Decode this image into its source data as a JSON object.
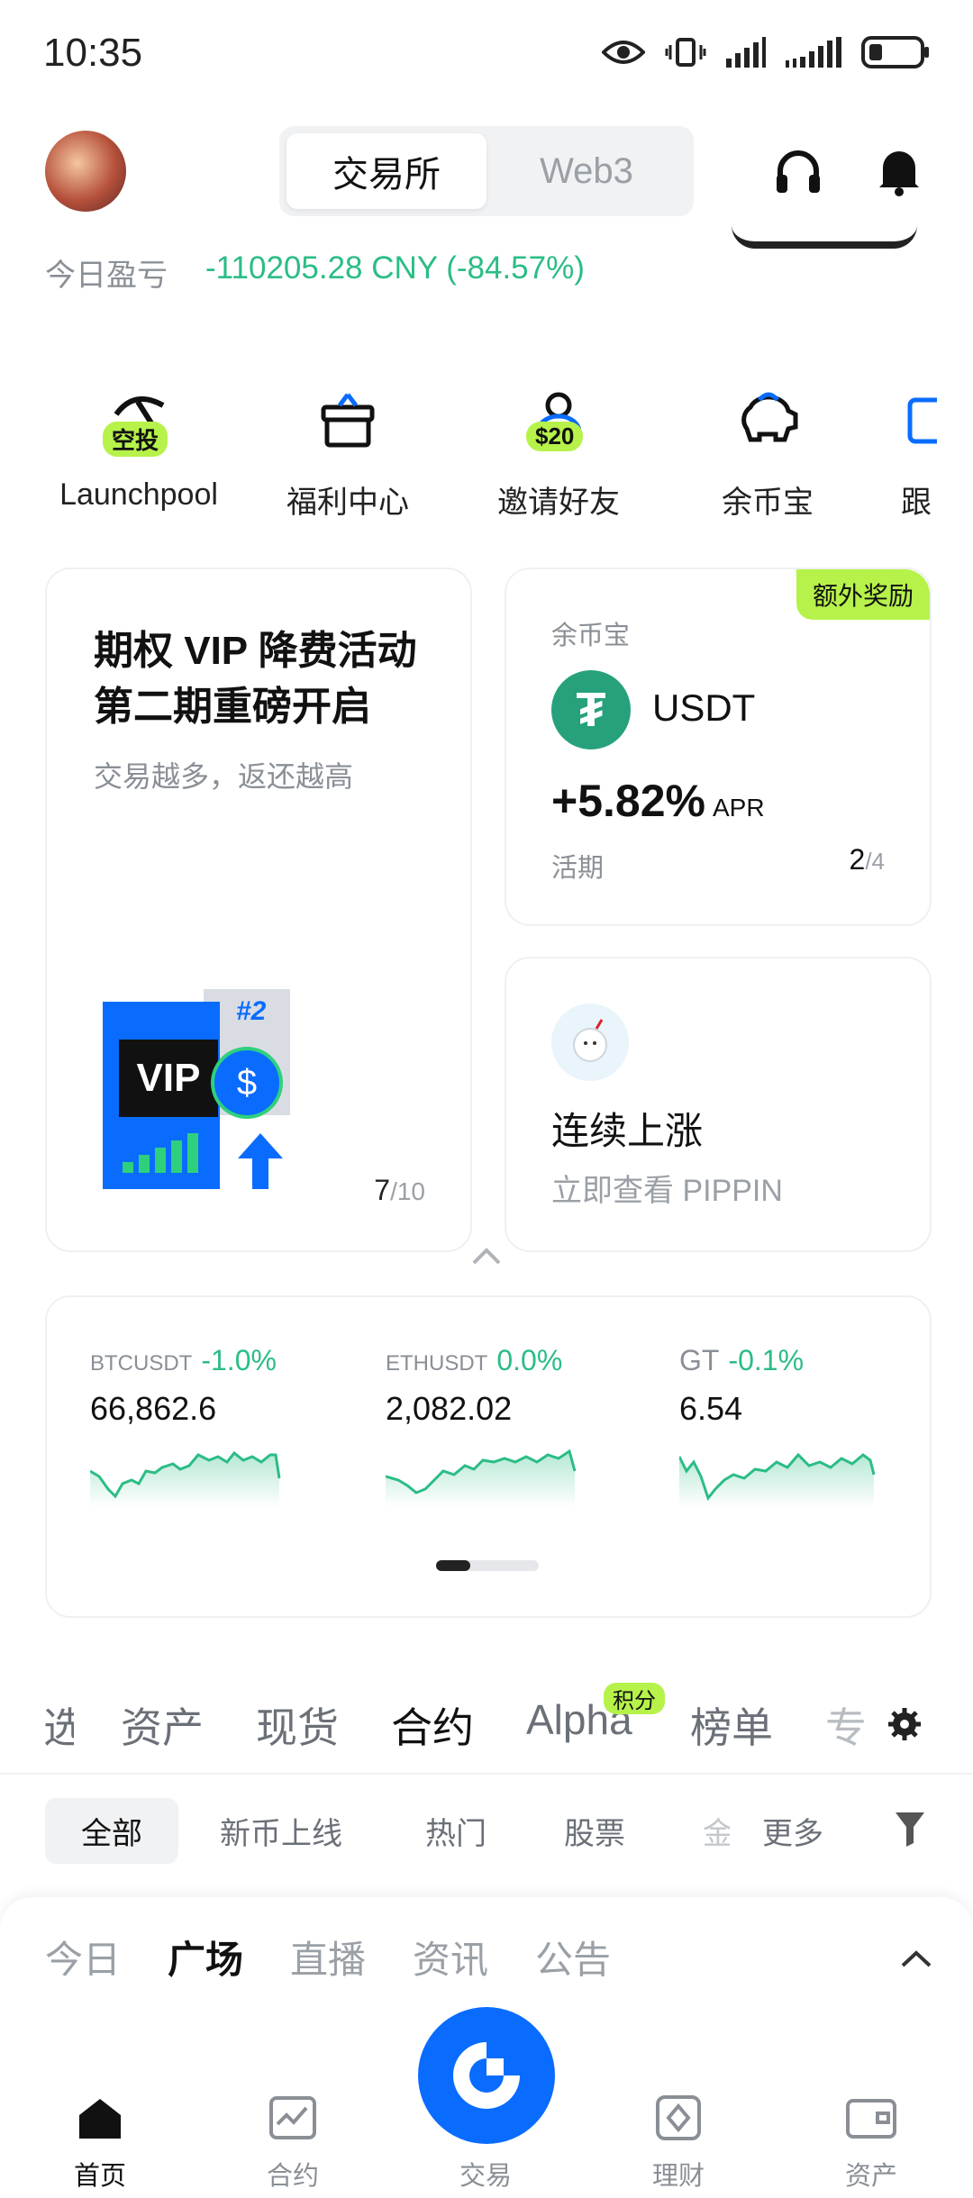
{
  "status": {
    "time": "10:35"
  },
  "header": {
    "segment_active": "交易所",
    "segment_inactive": "Web3",
    "pnl_label": "今日盈亏",
    "pnl_value": "-110205.28 CNY (-84.57%)"
  },
  "shortcuts": [
    {
      "label": "Launchpool",
      "icon": "pickaxe-icon",
      "tag": "空投"
    },
    {
      "label": "福利中心",
      "icon": "gift-icon",
      "tag": ""
    },
    {
      "label": "邀请好友",
      "icon": "user-icon",
      "tag": "$20"
    },
    {
      "label": "余币宝",
      "icon": "piggy-bank-icon",
      "tag": ""
    },
    {
      "label": "跟",
      "icon": "copy-icon",
      "tag": ""
    }
  ],
  "promo_card": {
    "title": "期权 VIP 降费活动 第二期重磅开启",
    "subtitle": "交易越多，返还越高",
    "badge_vip": "VIP",
    "badge_rank": "#2",
    "page_current": "7",
    "page_total": "/10"
  },
  "earn_card": {
    "bonus_tag": "额外奖励",
    "label": "余币宝",
    "coin": "USDT",
    "apr": "+5.82%",
    "apr_unit": "APR",
    "term": "活期",
    "page_current": "2",
    "page_total": "/4"
  },
  "rise_card": {
    "title": "连续上涨",
    "subtitle": "立即查看 PIPPIN"
  },
  "tickers": [
    {
      "symbol": "BTCUSDT",
      "change": "-1.0%",
      "price": "66,862.6"
    },
    {
      "symbol": "ETHUSDT",
      "change": "0.0%",
      "price": "2,082.02"
    },
    {
      "symbol": "GT",
      "change": "-0.1%",
      "price": "6.54"
    }
  ],
  "tabs": [
    "选",
    "资产",
    "现货",
    "合约",
    "Alpha",
    "榜单",
    "专"
  ],
  "tabs_active": "合约",
  "alpha_tag": "积分",
  "subtabs": [
    "全部",
    "新币上线",
    "热门",
    "股票",
    "金",
    "更多"
  ],
  "feed_tabs": [
    "今日",
    "广场",
    "直播",
    "资讯",
    "公告"
  ],
  "bottom_nav": [
    {
      "label": "首页",
      "icon": "home-icon"
    },
    {
      "label": "合约",
      "icon": "chart-icon"
    },
    {
      "label": "交易",
      "icon": "trade-icon"
    },
    {
      "label": "理财",
      "icon": "finance-icon"
    },
    {
      "label": "资产",
      "icon": "wallet-icon"
    }
  ],
  "colors": {
    "accent": "#0a6cff",
    "down": "#2bbd85",
    "tag": "#b6f24a"
  }
}
